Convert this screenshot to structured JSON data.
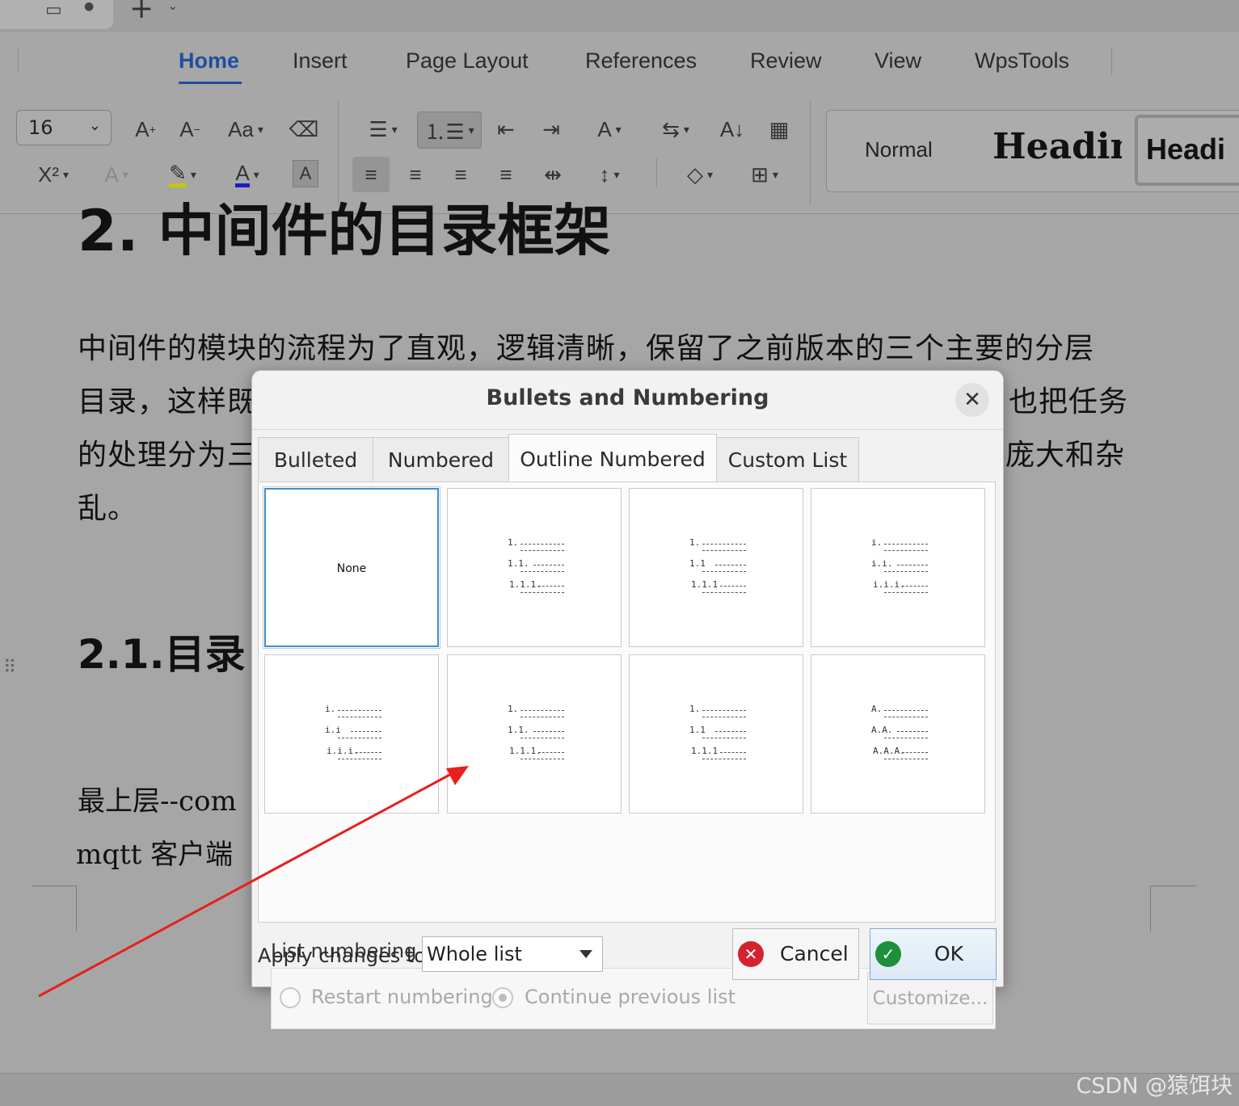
{
  "app": {
    "menu_tabs": [
      "Home",
      "Insert",
      "Page Layout",
      "References",
      "Review",
      "View",
      "WpsTools"
    ],
    "active_tab": "Home",
    "font_size": "16",
    "styles": {
      "normal": "Normal",
      "heading1": "Heading",
      "heading2": "Headi"
    }
  },
  "document": {
    "heading2": "2. 中间件的目录框架",
    "para1_line1": "中间件的模块的流程为了直观，逻辑清晰，保留了之前版本的三个主要的分层",
    "para1_line2_left": "目录，这样既",
    "para1_line2_right": "也把任务",
    "para1_line3_left": "的处理分为三",
    "para1_line3_right": "庞大和杂",
    "para1_line4": "乱。",
    "heading21": "2.1.目录",
    "para2_line1": "最上层--com",
    "para2_line2": "mqtt 客户端"
  },
  "dialog": {
    "title": "Bullets and Numbering",
    "tabs": [
      "Bulleted",
      "Numbered",
      "Outline Numbered",
      "Custom List"
    ],
    "active_tab": "Outline Numbered",
    "none_label": "None",
    "list_numbering_label": "List numbering",
    "restart_label": "Restart numbering",
    "continue_label": "Continue previous list",
    "customize_label": "Customize...",
    "apply_label": "Apply changes to:",
    "apply_value": "Whole list",
    "cancel_label": "Cancel",
    "ok_label": "OK",
    "presets": [
      [
        "1.",
        "1.1.",
        "1.1.1."
      ],
      [
        "1.",
        "1.1",
        "1.1.1"
      ],
      [
        "i.",
        "i.i.",
        "i.i.i."
      ],
      [
        "i.",
        "i.i",
        "i.i.i."
      ],
      [
        "1.",
        "1.1.",
        "1.1.1."
      ],
      [
        "1.",
        "1.1",
        "1.1.1"
      ],
      [
        "A.",
        "A.A.",
        "A.A.A."
      ]
    ]
  },
  "watermark": "CSDN @猿饵块",
  "colors": {
    "accent": "#1f4f9e",
    "selection": "#3b8fd0",
    "ok_green": "#1e8f3a",
    "cancel_red": "#d4232e",
    "arrow": "#e8201c"
  }
}
